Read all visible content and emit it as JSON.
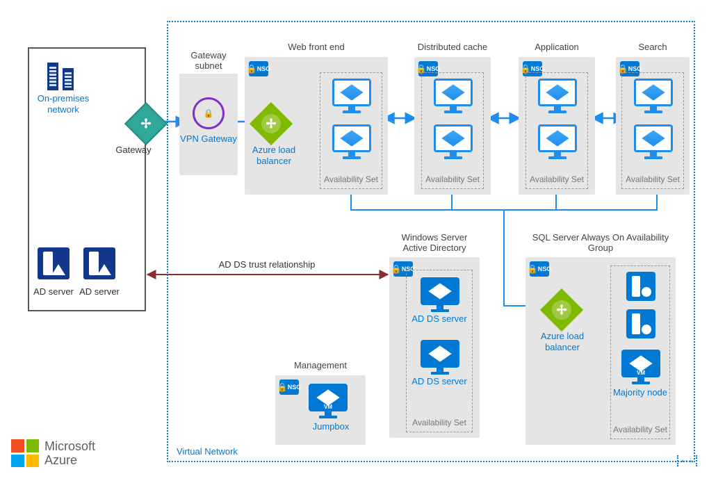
{
  "onprem": {
    "title": "On-premises network",
    "ad1_label": "AD server",
    "ad2_label": "AD server",
    "gateway_label": "Gateway"
  },
  "vnet": {
    "label": "Virtual Network",
    "gateway_subnet_title": "Gateway subnet",
    "vpn_label": "VPN Gateway",
    "nsg_label": "NSG"
  },
  "tiers": {
    "web": {
      "title": "Web front end",
      "lb_label": "Azure load balancer",
      "as_label": "Availability Set"
    },
    "cache": {
      "title": "Distributed cache",
      "as_label": "Availability Set"
    },
    "app": {
      "title": "Application",
      "as_label": "Availability Set"
    },
    "search": {
      "title": "Search",
      "as_label": "Availability Set"
    }
  },
  "ad_ds": {
    "title": "Windows Server Active Directory",
    "server_label": "AD DS server",
    "as_label": "Availability Set",
    "trust_label": "AD DS trust relationship"
  },
  "sql": {
    "title": "SQL Server Always On Availability Group",
    "lb_label": "Azure load balancer",
    "majority_label": "Majority node",
    "as_label": "Availability Set"
  },
  "management": {
    "title": "Management",
    "jumpbox_label": "Jumpbox",
    "vm_tag": "VM"
  },
  "branding": {
    "line1": "Microsoft",
    "line2": "Azure"
  }
}
